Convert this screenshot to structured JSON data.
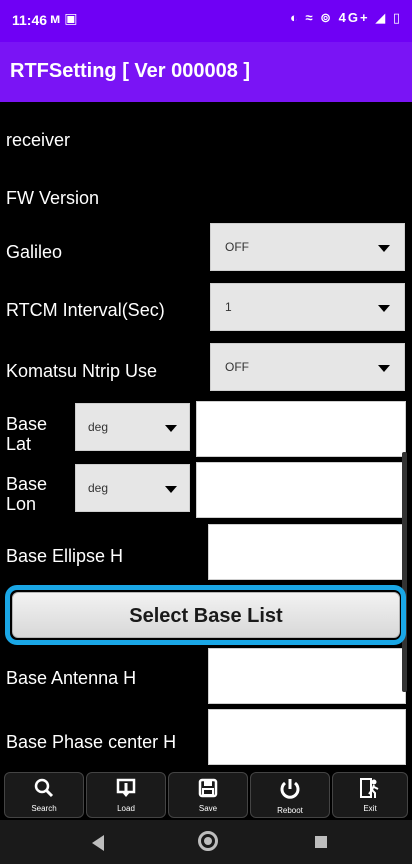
{
  "status_bar": {
    "time": "11:46",
    "left_icons": "ᴍ ▣",
    "right_icons": "◐ ≈ ⊚ 4G+ ◢ ▯"
  },
  "title_bar": {
    "title": "RTFSetting  [ Ver 000008 ]"
  },
  "form": {
    "receiver_label": "receiver",
    "fw_version_label": "FW Version",
    "galileo_label": "Galileo",
    "galileo_value": "OFF",
    "rtcm_interval_label": "RTCM Interval(Sec)",
    "rtcm_interval_value": "1",
    "komatsu_ntrip_label": "Komatsu Ntrip Use",
    "komatsu_ntrip_value": "OFF",
    "base_lat_label_1": "Base",
    "base_lat_label_2": "Lat",
    "base_lat_unit": "deg",
    "base_lon_label_1": "Base",
    "base_lon_label_2": "Lon",
    "base_lon_unit": "deg",
    "base_ellipse_label": "Base Ellipse H",
    "select_base_list_label": "Select Base List",
    "base_antenna_label": "Base Antenna H",
    "base_phase_center_label": "Base Phase center H"
  },
  "toolbar": {
    "search_label": "Search",
    "load_label": "Load",
    "save_label": "Save",
    "reboot_label": "Reboot",
    "exit_label": "Exit"
  },
  "icons": {
    "search": "search-icon",
    "load": "load-icon",
    "save": "save-icon",
    "reboot": "power-icon",
    "exit": "exit-icon"
  },
  "colors": {
    "title_bar": "#7a14f5",
    "status_bar": "#6f00f5",
    "highlight": "#1aa7e6"
  }
}
